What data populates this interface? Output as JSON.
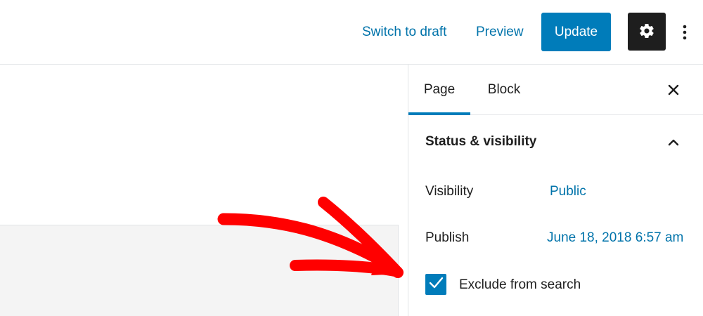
{
  "header": {
    "switch_to_draft": "Switch to draft",
    "preview": "Preview",
    "update": "Update"
  },
  "sidebar": {
    "tabs": [
      {
        "label": "Page",
        "active": true
      },
      {
        "label": "Block",
        "active": false
      }
    ],
    "panel": {
      "title": "Status & visibility",
      "expanded": true,
      "visibility_label": "Visibility",
      "visibility_value": "Public",
      "publish_label": "Publish",
      "publish_value": "June 18, 2018 6:57 am",
      "exclude_label": "Exclude from search",
      "exclude_checked": true
    }
  },
  "icons": {
    "settings": "gear-icon",
    "more": "vertical-ellipsis-icon",
    "close": "close-icon",
    "chevron": "chevron-up-icon",
    "check": "checkmark-icon"
  },
  "colors": {
    "accent": "#007cba",
    "link": "#0073aa",
    "dark": "#1e1e1e",
    "annotation": "#ff0000"
  }
}
